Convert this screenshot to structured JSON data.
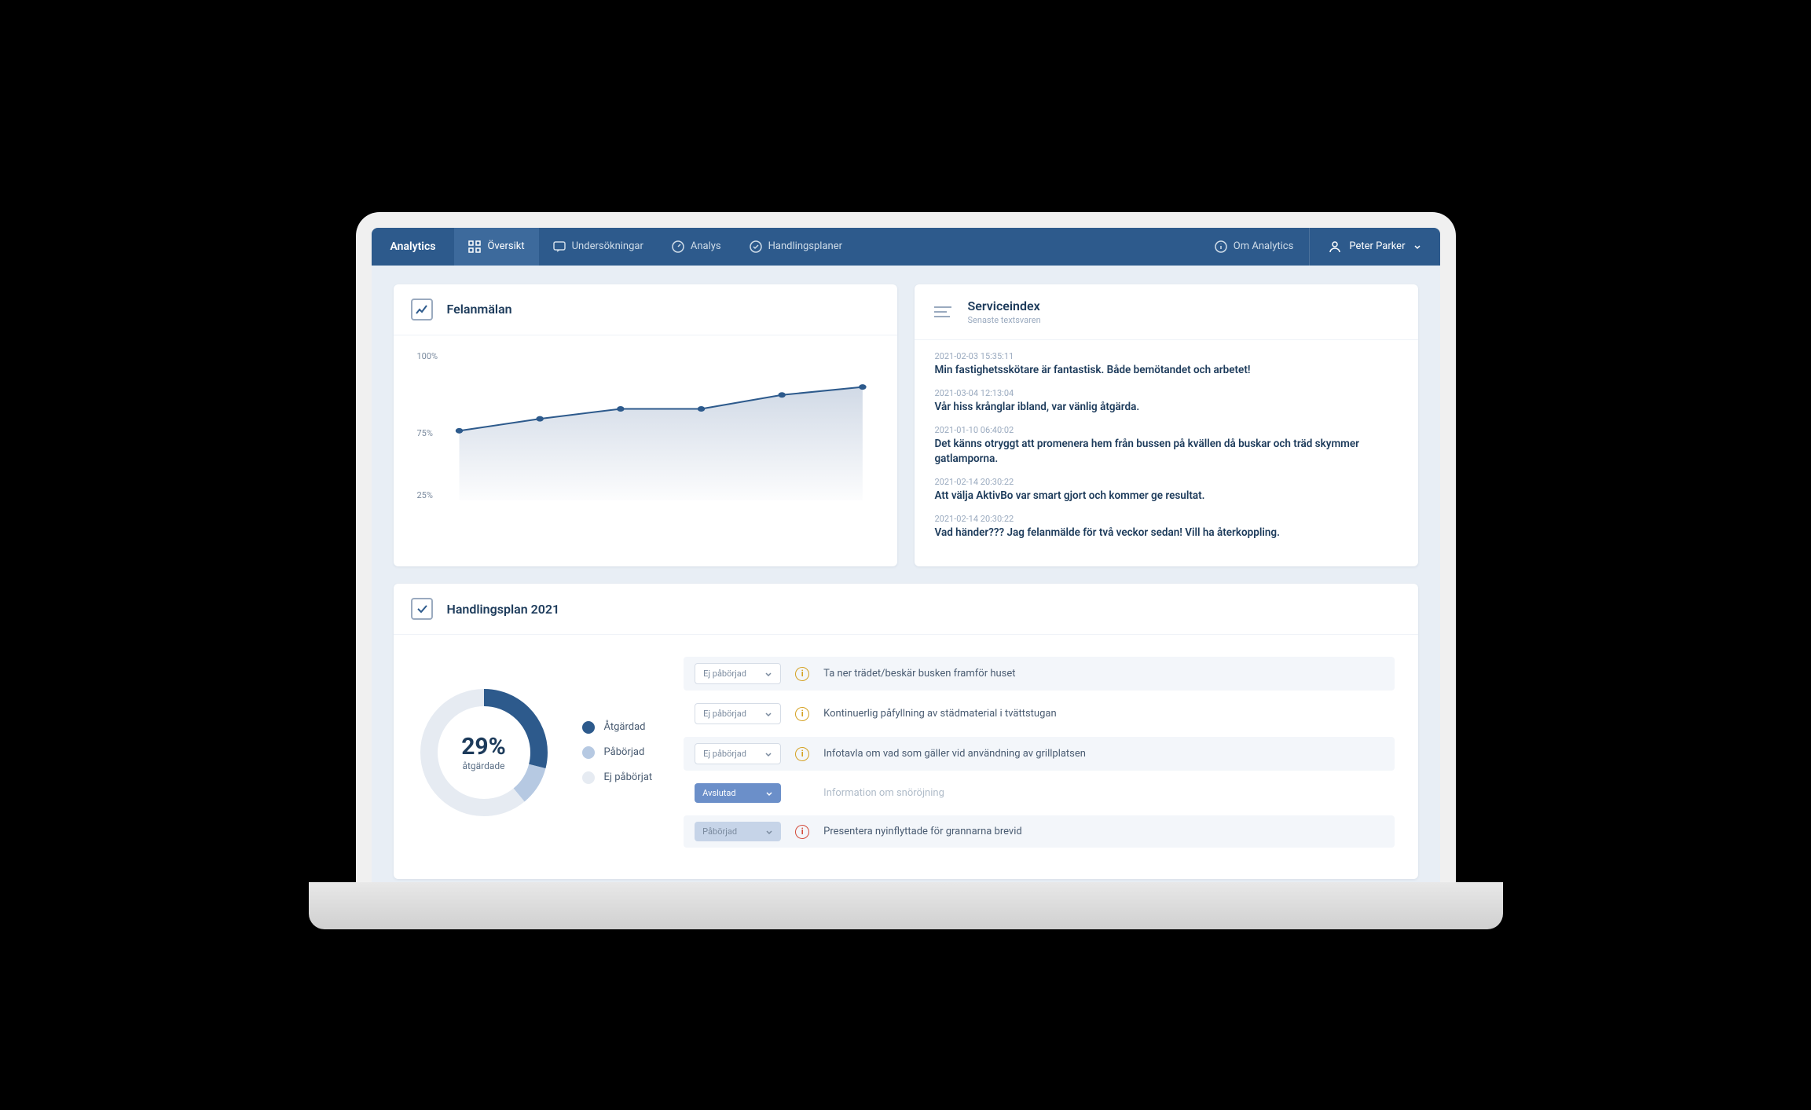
{
  "brand": "Analytics",
  "nav": [
    {
      "label": "Översikt",
      "active": true
    },
    {
      "label": "Undersökningar",
      "active": false
    },
    {
      "label": "Analys",
      "active": false
    },
    {
      "label": "Handlingsplaner",
      "active": false
    }
  ],
  "about_label": "Om Analytics",
  "user_name": "Peter Parker",
  "card_chart": {
    "title": "Felanmälan"
  },
  "card_feed": {
    "title": "Serviceindex",
    "subtitle": "Senaste textsvaren",
    "items": [
      {
        "ts": "2021-02-03 15:35:11",
        "text": "Min fastighetsskötare är fantastisk. Både bemötandet och arbetet!"
      },
      {
        "ts": "2021-03-04 12:13:04",
        "text": "Vår hiss krånglar ibland, var vänlig åtgärda."
      },
      {
        "ts": "2021-01-10 06:40:02",
        "text": "Det känns otryggt att promenera hem från bussen på kvällen då buskar och träd skymmer gatlamporna."
      },
      {
        "ts": "2021-02-14 20:30:22",
        "text": "Att välja AktivBo var smart gjort och kommer ge resultat."
      },
      {
        "ts": "2021-02-14 20:30:22",
        "text": "Vad händer??? Jag felanmälde för två veckor sedan! Vill ha återkoppling."
      }
    ]
  },
  "card_plan": {
    "title": "Handlingsplan 2021",
    "percent": "29%",
    "percent_label": "åtgärdade",
    "legend": [
      {
        "label": "Åtgärdad",
        "color": "#2d5a8c"
      },
      {
        "label": "Påbörjad",
        "color": "#b6c9e2"
      },
      {
        "label": "Ej påbörjat",
        "color": "#e6ebf2"
      }
    ],
    "tasks": [
      {
        "status": "Ej påbörjad",
        "pill": "outline",
        "icon": "amber",
        "text": "Ta ner trädet/beskär busken framför huset",
        "alt": true
      },
      {
        "status": "Ej påbörjad",
        "pill": "outline",
        "icon": "amber",
        "text": "Kontinuerlig påfyllning av städmaterial i tvättstugan",
        "alt": false
      },
      {
        "status": "Ej påbörjad",
        "pill": "outline",
        "icon": "amber",
        "text": "Infotavla om vad som gäller vid användning av grillplatsen",
        "alt": true
      },
      {
        "status": "Avslutad",
        "pill": "blue",
        "icon": "",
        "text": "Information om snöröjning",
        "alt": false,
        "muted": true
      },
      {
        "status": "Påbörjad",
        "pill": "light",
        "icon": "red",
        "text": "Presentera nyinflyttade för grannarna brevid",
        "alt": true
      }
    ]
  },
  "chart_data": {
    "type": "line",
    "title": "Felanmälan",
    "ylabel": "",
    "xlabel": "",
    "ylim": [
      25,
      100
    ],
    "y_ticks": [
      "100%",
      "75%",
      "25%"
    ],
    "x": [
      1,
      2,
      3,
      4,
      5,
      6
    ],
    "values": [
      60,
      66,
      71,
      71,
      78,
      82
    ]
  },
  "donut_data": {
    "type": "pie",
    "segments": [
      {
        "label": "Åtgärdad",
        "value": 29,
        "color": "#2d5a8c"
      },
      {
        "label": "Påbörjad",
        "value": 10,
        "color": "#b6c9e2"
      },
      {
        "label": "Ej påbörjat",
        "value": 61,
        "color": "#e6ebf2"
      }
    ]
  }
}
